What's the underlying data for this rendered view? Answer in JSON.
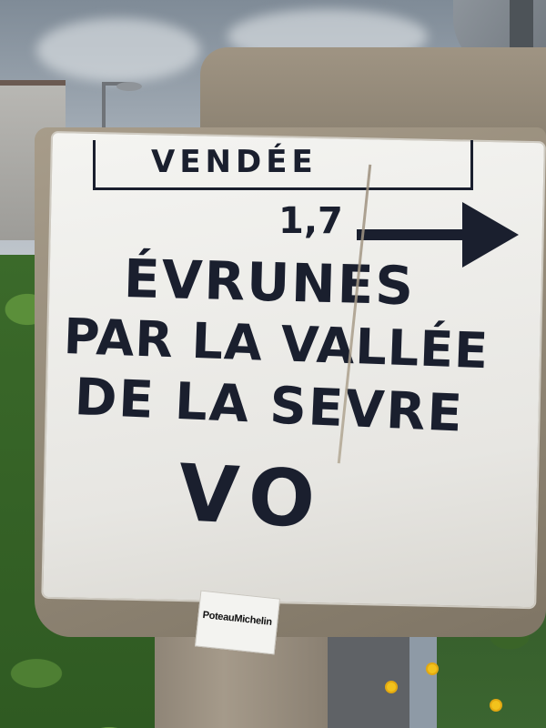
{
  "sign": {
    "region": "VENDÉE",
    "distance": "1,7",
    "line1": "ÉVRUNES",
    "line2": "PAR LA VALLÉE",
    "line3": "DE LA SEVRE",
    "line4": "VO"
  },
  "sticker": {
    "label": "PoteauMichelin"
  },
  "colors": {
    "sign_text": "#1a1f2e",
    "plate": "#f1f0ec",
    "stone": "#9a8f7c",
    "flowers": "#f2c21c"
  }
}
